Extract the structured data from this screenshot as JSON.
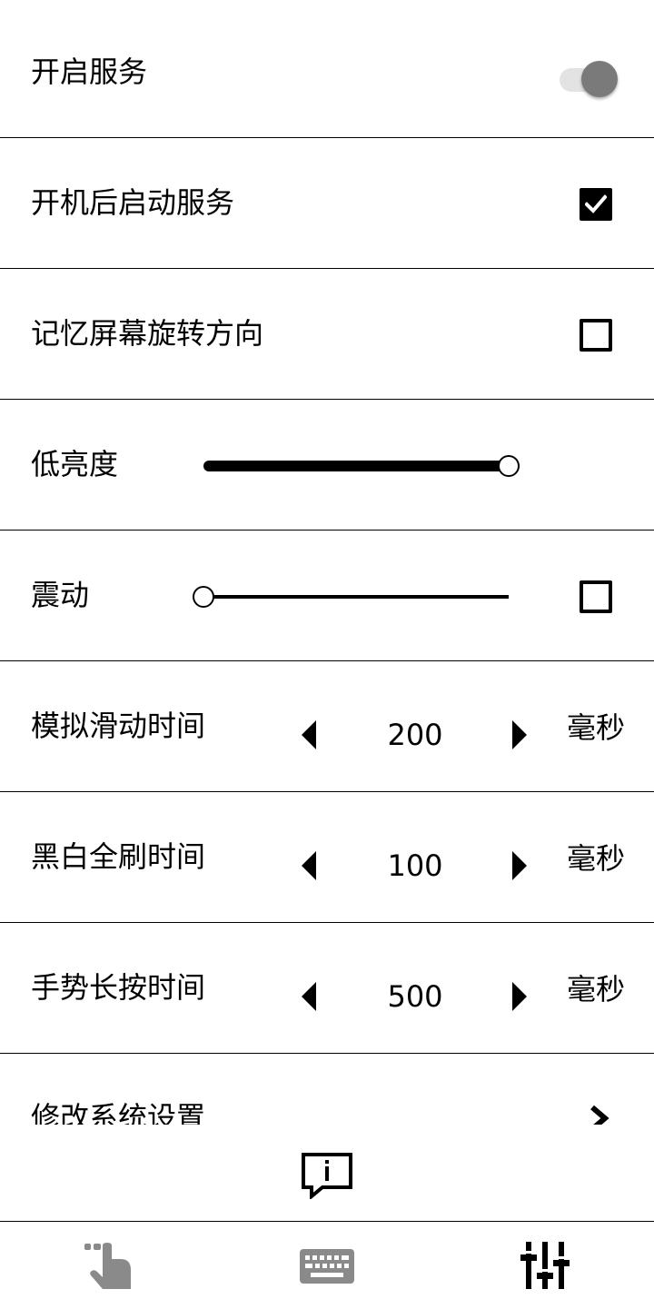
{
  "settings": {
    "service": {
      "label": "开启服务",
      "enabled": true
    },
    "boot_start": {
      "label": "开机后启动服务",
      "checked": true
    },
    "remember_rotation": {
      "label": "记忆屏幕旋转方向",
      "checked": false
    },
    "low_brightness": {
      "label": "低亮度",
      "level": 1.0
    },
    "vibration": {
      "label": "震动",
      "level": 0.0,
      "checked": false
    },
    "swipe_time": {
      "label": "模拟滑动时间",
      "value": "200",
      "unit": "毫秒"
    },
    "refresh_time": {
      "label": "黑白全刷时间",
      "value": "100",
      "unit": "毫秒"
    },
    "long_press_time": {
      "label": "手势长按时间",
      "value": "500",
      "unit": "毫秒"
    },
    "system_settings": {
      "label": "修改系统设置"
    }
  },
  "icons": {
    "info": "info-bubble-icon",
    "nav_gesture": "hand-pointer-icon",
    "nav_keyboard": "keyboard-icon",
    "nav_settings": "sliders-icon"
  },
  "colors": {
    "toggle_thumb": "#7a7a7a",
    "toggle_track": "#e3e3e3",
    "inactive_icon": "#8a8a8a",
    "active_icon": "#000000"
  },
  "bottom_nav": {
    "active_index": 2
  }
}
